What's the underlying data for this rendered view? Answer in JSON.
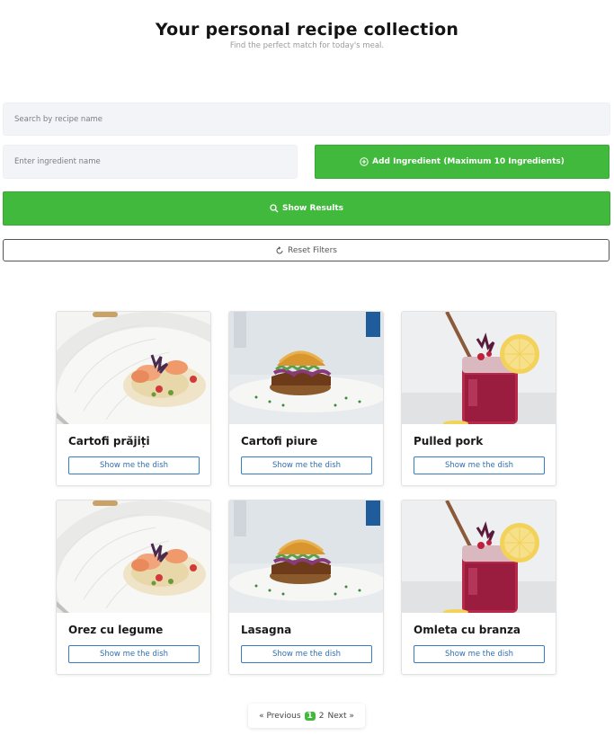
{
  "header": {
    "title": "Your personal recipe collection",
    "subtitle": "Find the perfect match for today's meal."
  },
  "search": {
    "placeholder": "Search by recipe name"
  },
  "ingredient": {
    "placeholder": "Enter ingredient name"
  },
  "buttons": {
    "add_ingredient": "Add Ingredient (Maximum 10 Ingredients)",
    "show_results": "Show Results",
    "reset_filters": "Reset Filters"
  },
  "recipes": [
    {
      "title": "Cartofi prăjiți",
      "image": "shrimp-dish",
      "button": "Show me the dish"
    },
    {
      "title": "Cartofi piure",
      "image": "burger",
      "button": "Show me the dish"
    },
    {
      "title": "Pulled pork",
      "image": "berry-drink",
      "button": "Show me the dish"
    },
    {
      "title": "Orez cu legume",
      "image": "shrimp-dish",
      "button": "Show me the dish"
    },
    {
      "title": "Lasagna",
      "image": "burger",
      "button": "Show me the dish"
    },
    {
      "title": "Omleta cu branza",
      "image": "berry-drink",
      "button": "Show me the dish"
    }
  ],
  "pagination": {
    "previous": "« Previous",
    "pages": [
      "1",
      "2"
    ],
    "current": "1",
    "next": "Next »"
  },
  "colors": {
    "accent_green": "#41b93c",
    "link_blue": "#2f6fb1",
    "input_bg": "#f3f4f8"
  }
}
